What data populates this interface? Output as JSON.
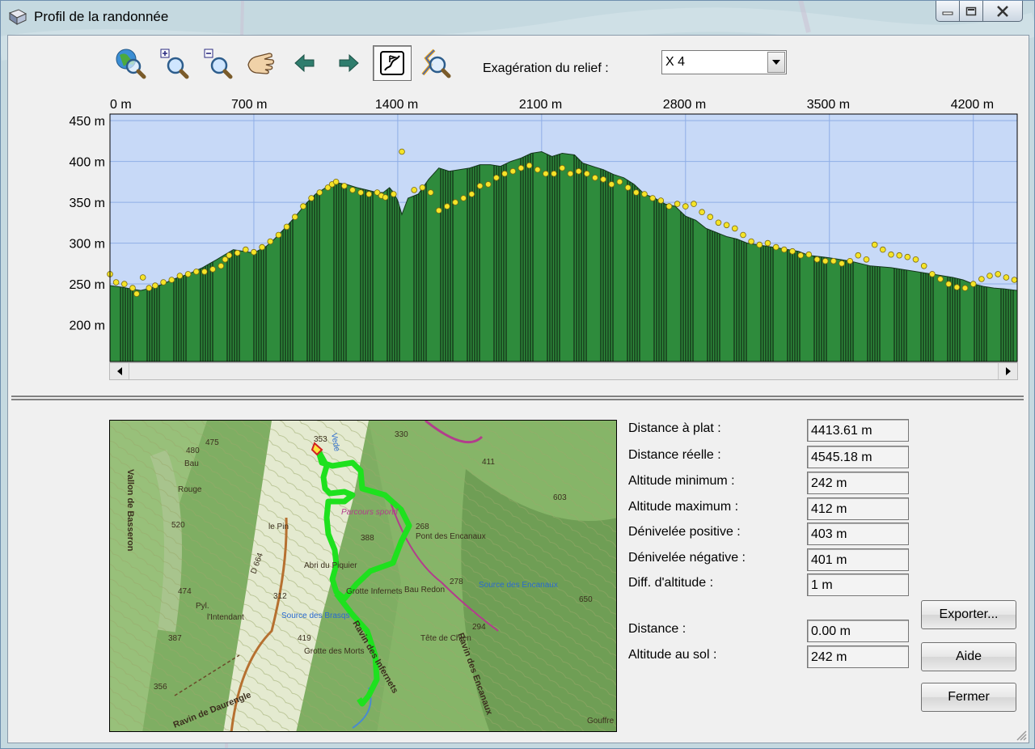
{
  "window": {
    "title": "Profil de la randonnée",
    "controls": [
      "minimize",
      "maximize",
      "close"
    ]
  },
  "toolbar": {
    "buttons": [
      {
        "name": "view-all",
        "icon": "globe-magnifier-icon"
      },
      {
        "name": "zoom-in",
        "icon": "zoom-in-icon"
      },
      {
        "name": "zoom-out",
        "icon": "zoom-out-icon"
      },
      {
        "name": "pan",
        "icon": "hand-icon"
      },
      {
        "name": "previous",
        "icon": "arrow-left-icon"
      },
      {
        "name": "next",
        "icon": "arrow-right-icon"
      },
      {
        "name": "profile-mode",
        "icon": "profile-flag-icon",
        "pressed": true
      },
      {
        "name": "route-zoom",
        "icon": "route-magnifier-icon"
      }
    ],
    "exaggeration_label": "Exagération du relief :",
    "exaggeration_value": "X 4"
  },
  "chart_data": {
    "type": "area",
    "title": "",
    "xlabel": "",
    "ylabel": "",
    "x_tick_labels": [
      "0 m",
      "700 m",
      "1400 m",
      "2100 m",
      "2800 m",
      "3500 m",
      "4200 m"
    ],
    "x_ticks": [
      0,
      700,
      1400,
      2100,
      2800,
      3500,
      4200
    ],
    "y_tick_labels": [
      "450 m",
      "400 m",
      "350 m",
      "300 m",
      "250 m",
      "200 m"
    ],
    "y_ticks": [
      450,
      400,
      350,
      300,
      250,
      200
    ],
    "xlim": [
      0,
      4413.61
    ],
    "ylim": [
      155,
      458
    ],
    "grid": true,
    "colors": {
      "sky": "#c7d9f7",
      "terrain": "#2e8b3c",
      "grid": "#8faee6",
      "points": "#f5e428"
    },
    "series": [
      {
        "kind": "terrain",
        "x": [
          0,
          60,
          100,
          150,
          200,
          260,
          300,
          380,
          450,
          520,
          600,
          650,
          700,
          760,
          800,
          850,
          900,
          960,
          1000,
          1050,
          1100,
          1150,
          1200,
          1250,
          1300,
          1330,
          1360,
          1380,
          1400,
          1420,
          1450,
          1500,
          1550,
          1600,
          1650,
          1700,
          1750,
          1800,
          1850,
          1900,
          1950,
          2000,
          2050,
          2100,
          2150,
          2200,
          2260,
          2300,
          2360,
          2400,
          2450,
          2500,
          2550,
          2600,
          2650,
          2700,
          2750,
          2800,
          2850,
          2900,
          2950,
          3000,
          3050,
          3100,
          3200,
          3300,
          3350,
          3400,
          3500,
          3600,
          3700,
          3800,
          3900,
          4000,
          4100,
          4150,
          4200,
          4250,
          4300,
          4350,
          4413
        ],
        "y": [
          248,
          246,
          244,
          242,
          245,
          250,
          255,
          262,
          270,
          280,
          292,
          290,
          288,
          296,
          305,
          318,
          332,
          350,
          360,
          368,
          374,
          372,
          368,
          365,
          362,
          362,
          368,
          362,
          352,
          335,
          355,
          360,
          378,
          392,
          388,
          390,
          392,
          396,
          396,
          394,
          400,
          404,
          410,
          412,
          406,
          410,
          408,
          398,
          393,
          390,
          384,
          380,
          372,
          360,
          355,
          348,
          345,
          333,
          328,
          318,
          313,
          308,
          305,
          300,
          296,
          292,
          290,
          285,
          282,
          278,
          272,
          270,
          266,
          262,
          258,
          255,
          250,
          247,
          245,
          244,
          242
        ]
      },
      {
        "kind": "gps-points",
        "x": [
          0,
          30,
          70,
          110,
          130,
          160,
          190,
          220,
          260,
          300,
          340,
          380,
          420,
          460,
          500,
          540,
          560,
          580,
          620,
          660,
          700,
          740,
          780,
          820,
          860,
          900,
          940,
          980,
          1020,
          1060,
          1080,
          1100,
          1140,
          1180,
          1220,
          1260,
          1300,
          1320,
          1340,
          1380,
          1420,
          1480,
          1520,
          1560,
          1600,
          1640,
          1680,
          1720,
          1760,
          1800,
          1840,
          1880,
          1920,
          1960,
          2000,
          2040,
          2080,
          2120,
          2160,
          2200,
          2240,
          2280,
          2320,
          2360,
          2400,
          2440,
          2480,
          2520,
          2560,
          2600,
          2640,
          2680,
          2720,
          2760,
          2800,
          2840,
          2880,
          2920,
          2960,
          3000,
          3040,
          3080,
          3120,
          3160,
          3200,
          3240,
          3280,
          3320,
          3360,
          3400,
          3440,
          3480,
          3520,
          3560,
          3600,
          3640,
          3680,
          3720,
          3760,
          3800,
          3840,
          3880,
          3920,
          3960,
          4000,
          4040,
          4080,
          4120,
          4160,
          4200,
          4240,
          4280,
          4320,
          4360,
          4400
        ],
        "y": [
          262,
          252,
          250,
          245,
          238,
          258,
          245,
          248,
          252,
          255,
          260,
          262,
          265,
          265,
          268,
          272,
          280,
          285,
          288,
          292,
          289,
          295,
          302,
          310,
          320,
          332,
          345,
          355,
          362,
          368,
          372,
          375,
          370,
          365,
          362,
          360,
          362,
          358,
          356,
          360,
          412,
          365,
          368,
          362,
          340,
          345,
          350,
          355,
          360,
          370,
          372,
          380,
          385,
          388,
          392,
          395,
          390,
          385,
          385,
          392,
          385,
          388,
          385,
          380,
          378,
          372,
          375,
          368,
          362,
          360,
          355,
          352,
          345,
          348,
          345,
          348,
          338,
          332,
          325,
          322,
          318,
          310,
          302,
          298,
          300,
          295,
          292,
          290,
          285,
          286,
          280,
          278,
          278,
          275,
          278,
          285,
          280,
          298,
          292,
          286,
          285,
          283,
          280,
          272,
          262,
          256,
          250,
          246,
          245,
          250,
          256,
          260,
          262,
          258,
          255
        ]
      }
    ]
  },
  "map": {
    "labels": [
      "Vede",
      "330",
      "411",
      "480",
      "475",
      "Bau",
      "Rouge",
      "Vallon de Basseron",
      "520",
      "Parcours sportif",
      "le Pin",
      "268",
      "Pont des Encanaux",
      "603",
      "388",
      "Abri du Piquier",
      "D 664",
      "Bau Redon",
      "278",
      "Source des Encanaux",
      "650",
      "474",
      "312",
      "Grotte Infernets",
      "Pyl.",
      "l'Intendant",
      "Source des Brasqs",
      "419",
      "Ravin des Infernets",
      "Tête de Chien",
      "294",
      "387",
      "Grotte des Morts",
      "Ravin des Encanaux",
      "356",
      "Ravin de Daurengle",
      "Gouffre des Encanaux",
      "353"
    ]
  },
  "stats": [
    {
      "label": "Distance à plat :",
      "value": "4413.61 m"
    },
    {
      "label": "Distance réelle :",
      "value": "4545.18 m"
    },
    {
      "label": "Altitude minimum :",
      "value": "242 m"
    },
    {
      "label": "Altitude maximum :",
      "value": "412 m"
    },
    {
      "label": "Dénivelée positive :",
      "value": "403 m"
    },
    {
      "label": "Dénivelée négative :",
      "value": "401 m"
    },
    {
      "label": "Diff. d'altitude :",
      "value": "1 m"
    }
  ],
  "cursor_info": [
    {
      "label": "Distance :",
      "value": "0.00 m"
    },
    {
      "label": "Altitude au sol :",
      "value": "242 m"
    }
  ],
  "buttons": {
    "export": "Exporter...",
    "help": "Aide",
    "close": "Fermer"
  }
}
